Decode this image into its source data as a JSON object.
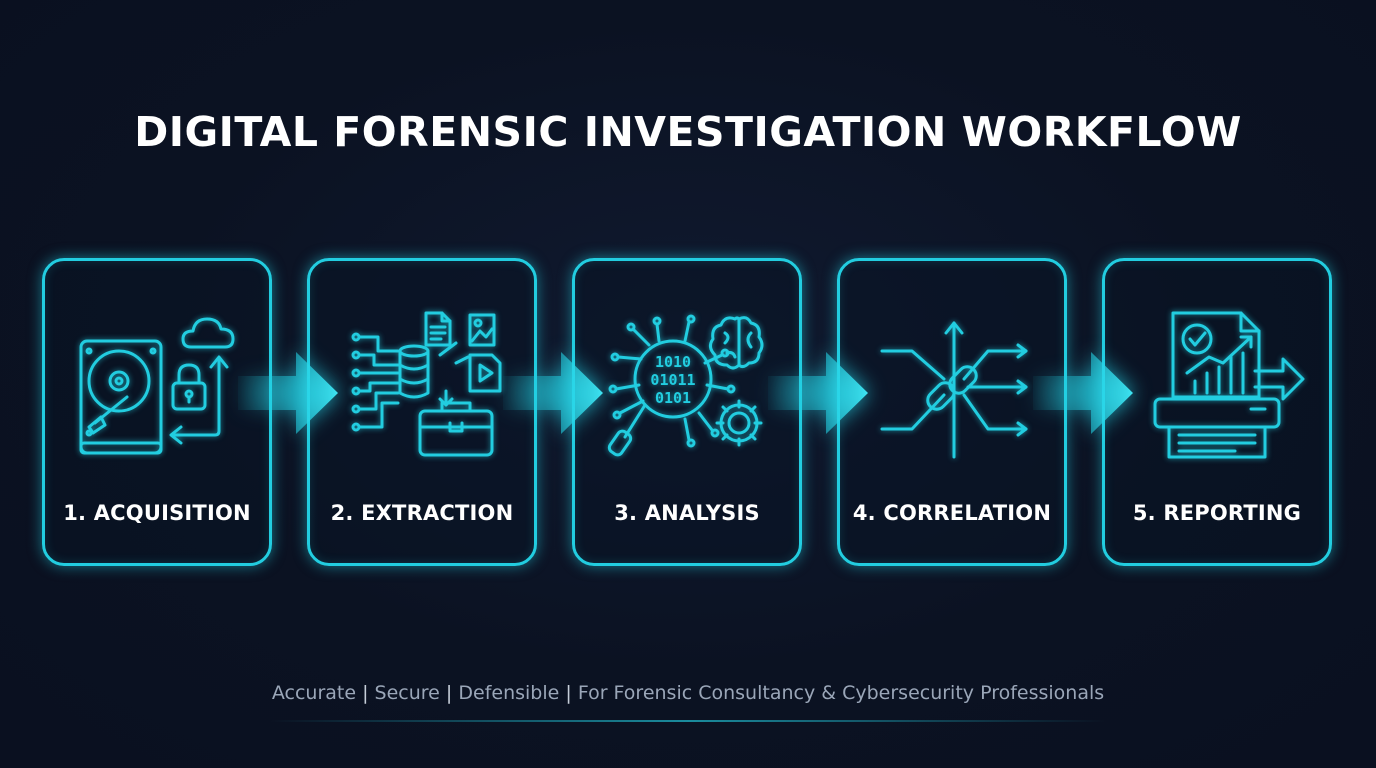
{
  "title": "DIGITAL FORENSIC INVESTIGATION WORKFLOW",
  "accent_color": "#22cde0",
  "background_color": "#0b1222",
  "steps": [
    {
      "label": "1. ACQUISITION",
      "icon": "hard-drive-cloud-lock-icon"
    },
    {
      "label": "2. EXTRACTION",
      "icon": "data-extraction-database-toolbox-icon"
    },
    {
      "label": "3. ANALYSIS",
      "icon": "binary-magnifier-brain-gear-icon"
    },
    {
      "label": "4. CORRELATION",
      "icon": "linked-chain-arrows-icon"
    },
    {
      "label": "5. REPORTING",
      "icon": "report-printer-chart-icon"
    }
  ],
  "footer": {
    "items": [
      "Accurate",
      "Secure",
      "Defensible",
      "For Forensic Consultancy & Cybersecurity Professionals"
    ],
    "separator": "|"
  }
}
